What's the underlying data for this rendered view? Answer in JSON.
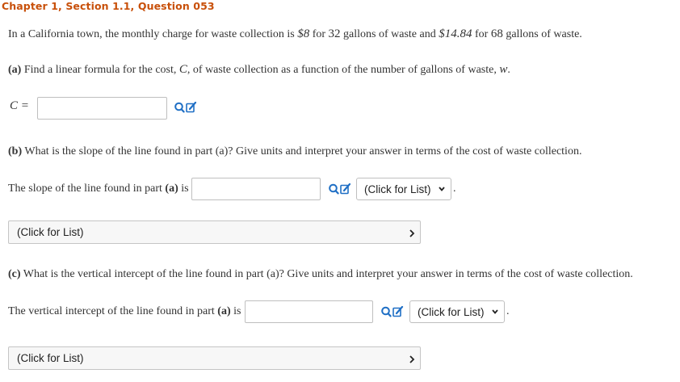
{
  "header": {
    "title": "Chapter 1, Section 1.1, Question 053"
  },
  "problem": {
    "intro_a": "In a California town, the monthly charge for waste collection is ",
    "price1": "$8",
    "intro_b": " for ",
    "gal1": "32",
    "intro_c": " gallons of waste and ",
    "price2": "$14.84",
    "intro_d": " for ",
    "gal2": "68",
    "intro_e": " gallons of waste."
  },
  "part_a": {
    "label": "(a)",
    "text_a": " Find a linear formula for the cost, ",
    "var_c": "C",
    "text_b": ", of waste collection as a function of the number of gallons of waste, ",
    "var_w": "w",
    "text_c": ".",
    "answer_label": "C =",
    "answer_value": ""
  },
  "part_b": {
    "label": "(b)",
    "question": " What is the slope of the line found in part (a)? Give units and interpret your answer in terms of the cost of waste collection.",
    "sentence_a": "The slope of the line found in part ",
    "sentence_ref": "(a)",
    "sentence_b": " is",
    "answer_value": "",
    "units_select": "(Click for List)",
    "interpret_select": "(Click for List)"
  },
  "part_c": {
    "label": "(c)",
    "question": " What is the vertical intercept of the line found in part (a)? Give units and interpret your answer in terms of the cost of waste collection.",
    "sentence_a": "The vertical intercept of the line found in part ",
    "sentence_ref": "(a)",
    "sentence_b": " is",
    "answer_value": "",
    "units_select": "(Click for List)",
    "interpret_select": "(Click for List)"
  },
  "punct": {
    "period": "."
  },
  "icons": {
    "search": "search-icon",
    "edit": "edit-icon",
    "chevron": "chevron-down-icon"
  },
  "colors": {
    "title": "#c8500a",
    "icon": "#1f6fc5"
  }
}
